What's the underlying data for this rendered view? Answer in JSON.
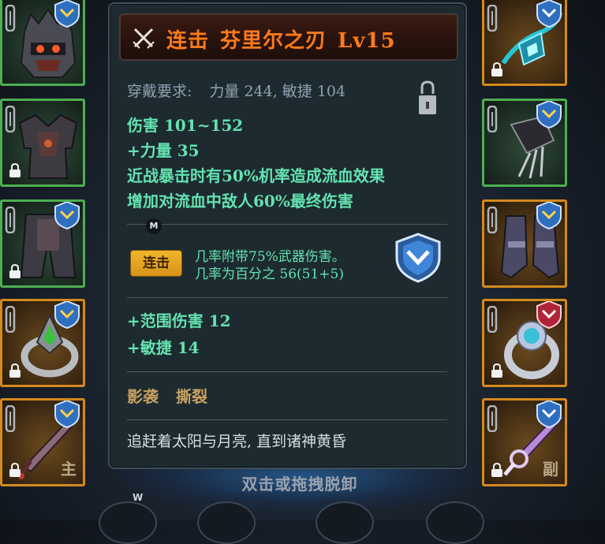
{
  "tooltip": {
    "title": {
      "type": "连击",
      "name": "芬里尔之刃",
      "level": "Lv15"
    },
    "requirement": {
      "label": "穿戴要求:",
      "value": "力量 244, 敏捷 104"
    },
    "stats": {
      "damage": "伤害  101~152",
      "strength": "+力量 35",
      "effect1": "近战暴击时有50%机率造成流血效果",
      "effect2": "增加对流血中敌人60%最终伤害"
    },
    "hotkey_m": "M",
    "skill": {
      "tag": "连击",
      "line1": "几率附带75%武器伤害。",
      "line2": "几率为百分之 56(51+5)"
    },
    "bonus": {
      "area_damage": "+范围伤害 12",
      "agility": "+敏捷 14"
    },
    "set": {
      "part1": "影袭",
      "part2": "撕裂"
    },
    "flavor": "追赶着太阳与月亮, 直到诸神黄昏"
  },
  "left_slots": [
    {
      "item": "helmet-icon",
      "frame": "green",
      "locked": false
    },
    {
      "item": "armor-icon",
      "frame": "green",
      "locked": true
    },
    {
      "item": "pants-icon",
      "frame": "green",
      "locked": true
    },
    {
      "item": "ring-icon",
      "frame": "orange",
      "locked": true
    },
    {
      "item": "sword-icon",
      "frame": "orange",
      "locked": true,
      "label": "主"
    }
  ],
  "right_slots": [
    {
      "item": "amulet-icon",
      "frame": "orange",
      "locked": true
    },
    {
      "item": "claw-glove-icon",
      "frame": "green",
      "locked": false
    },
    {
      "item": "boots-icon",
      "frame": "orange",
      "locked": false
    },
    {
      "item": "ring-icon",
      "frame": "orange",
      "locked": true
    },
    {
      "item": "dagger-icon",
      "frame": "orange",
      "locked": true,
      "label": "副"
    }
  ],
  "bottom_hint": "双击或拖拽脱卸",
  "hotkey_w": "W",
  "colors": {
    "title": "#ff7a1a",
    "stat_green": "#63e3b0",
    "set_gold": "#c7a061",
    "frame_green": "#4caf50",
    "frame_orange": "#d48a1c"
  }
}
